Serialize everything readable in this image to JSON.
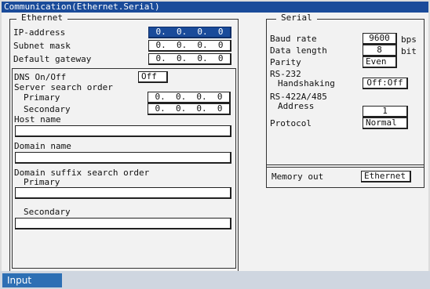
{
  "window": {
    "title": "Communication(Ethernet.Serial)"
  },
  "ethernet": {
    "title": "Ethernet",
    "ip_label": "IP-address",
    "ip_value": "0.  0.  0.  0",
    "subnet_label": "Subnet mask",
    "subnet_value": "0.  0.  0.  0",
    "gateway_label": "Default gateway",
    "gateway_value": "0.  0.  0.  0",
    "dns": {
      "onoff_label": "DNS On/Off",
      "onoff_value": "Off",
      "server_order_label": "Server search order",
      "primary_label": "Primary",
      "primary_value": "0.  0.  0.  0",
      "secondary_label": "Secondary",
      "secondary_value": "0.  0.  0.  0",
      "host_label": "Host name",
      "host_value": "",
      "domain_label": "Domain name",
      "domain_value": "",
      "suffix_label": "Domain suffix search order",
      "suffix_primary_label": "Primary",
      "suffix_primary_value": "",
      "suffix_secondary_label": "Secondary",
      "suffix_secondary_value": ""
    }
  },
  "serial": {
    "title": "Serial",
    "baud_label": "Baud rate",
    "baud_value": "9600",
    "baud_unit": "bps",
    "data_label": "Data length",
    "data_value": "8",
    "data_unit": "bit",
    "parity_label": "Parity",
    "parity_value": "Even",
    "rs232_label": "RS-232",
    "handshake_label": "Handshaking",
    "handshake_value": "Off:Off",
    "rs422_label": "RS-422A/485",
    "address_label": "Address",
    "address_value": "1",
    "protocol_label": "Protocol",
    "protocol_value": "Normal"
  },
  "memory": {
    "label": "Memory out",
    "value": "Ethernet"
  },
  "footer": {
    "input_label": "Input"
  }
}
